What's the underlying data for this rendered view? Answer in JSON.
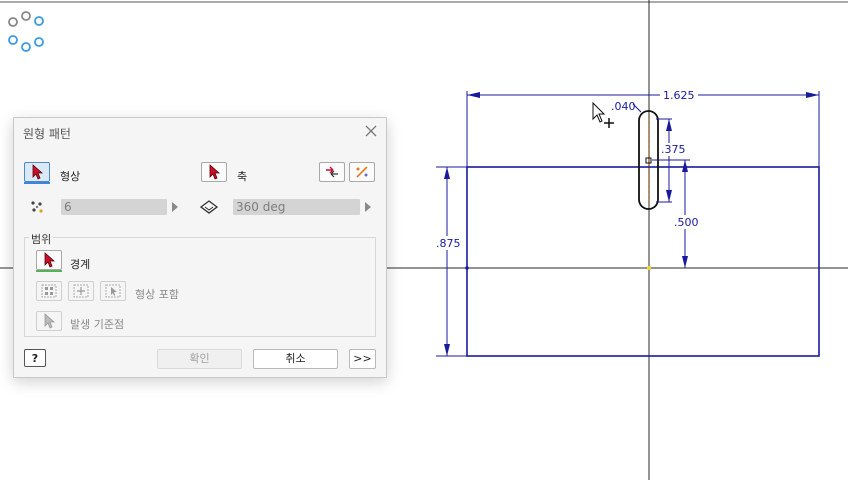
{
  "drawing": {
    "dimensions": {
      "overall_width": "1.625",
      "slot_offset": ".040",
      "slot_width": ".375",
      "slot_depth": ".500",
      "height": ".875"
    }
  },
  "dialog": {
    "title": "원형 패턴",
    "geometry_label": "형상",
    "axis_label": "축",
    "count_value": "6",
    "angle_value": "360 deg",
    "extents_group_title": "범위",
    "boundary_label": "경계",
    "include_features_label": "형상 포함",
    "base_point_label": "발생 기준점",
    "ok_label": "확인",
    "cancel_label": "취소",
    "more_label": ">>"
  },
  "colors": {
    "sketch": "#1a1a9c",
    "axis_line": "#222222",
    "accent_blue": "#4d88c7",
    "cursor_red": "#c8102e"
  }
}
